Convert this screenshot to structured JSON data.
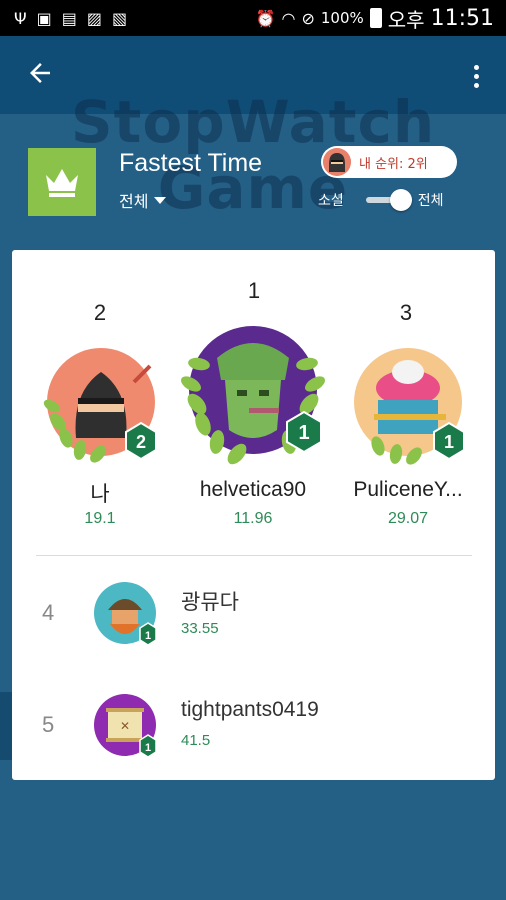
{
  "status_bar": {
    "battery_text": "100%",
    "ampm": "오후",
    "time": "11:51",
    "icons": [
      "usb-icon",
      "sim-card-icon",
      "sd-card-icon",
      "gallery-icon",
      "photo-icon",
      "alarm-icon",
      "wifi-icon",
      "no-disturb-icon",
      "battery-icon"
    ]
  },
  "appbar": {
    "back_icon": "arrow-back-icon",
    "more_icon": "more-vert-icon"
  },
  "header": {
    "watermark_line1": "StopWatch",
    "watermark_line2": "Game",
    "title": "Fastest Time",
    "scope_label": "전체",
    "my_rank": "내 순위: 2위",
    "toggle_left": "소셜",
    "toggle_right": "전체",
    "crown_color": "#8bc34a"
  },
  "podium": [
    {
      "rank": "2",
      "name": "나",
      "score": "19.1",
      "badge": "2",
      "avatar": "ninja-avatar"
    },
    {
      "rank": "1",
      "name": "helvetica90",
      "score": "11.96",
      "badge": "1",
      "avatar": "soldier-avatar"
    },
    {
      "rank": "3",
      "name": "PuliceneY...",
      "score": "29.07",
      "badge": "1",
      "avatar": "cupcake-avatar"
    }
  ],
  "list": [
    {
      "rank": "4",
      "name": "광뮤다",
      "score": "33.55",
      "badge": "1",
      "avatar": "viking-avatar"
    },
    {
      "rank": "5",
      "name": "tightpants0419",
      "score": "41.5",
      "badge": "1",
      "avatar": "treasure-map-avatar"
    }
  ],
  "colors": {
    "background": "#245f86",
    "appbar": "#0f4d76",
    "score_green": "#2e8b57",
    "badge_green": "#1b7a4a",
    "rank_pill_text": "#c0392b"
  }
}
